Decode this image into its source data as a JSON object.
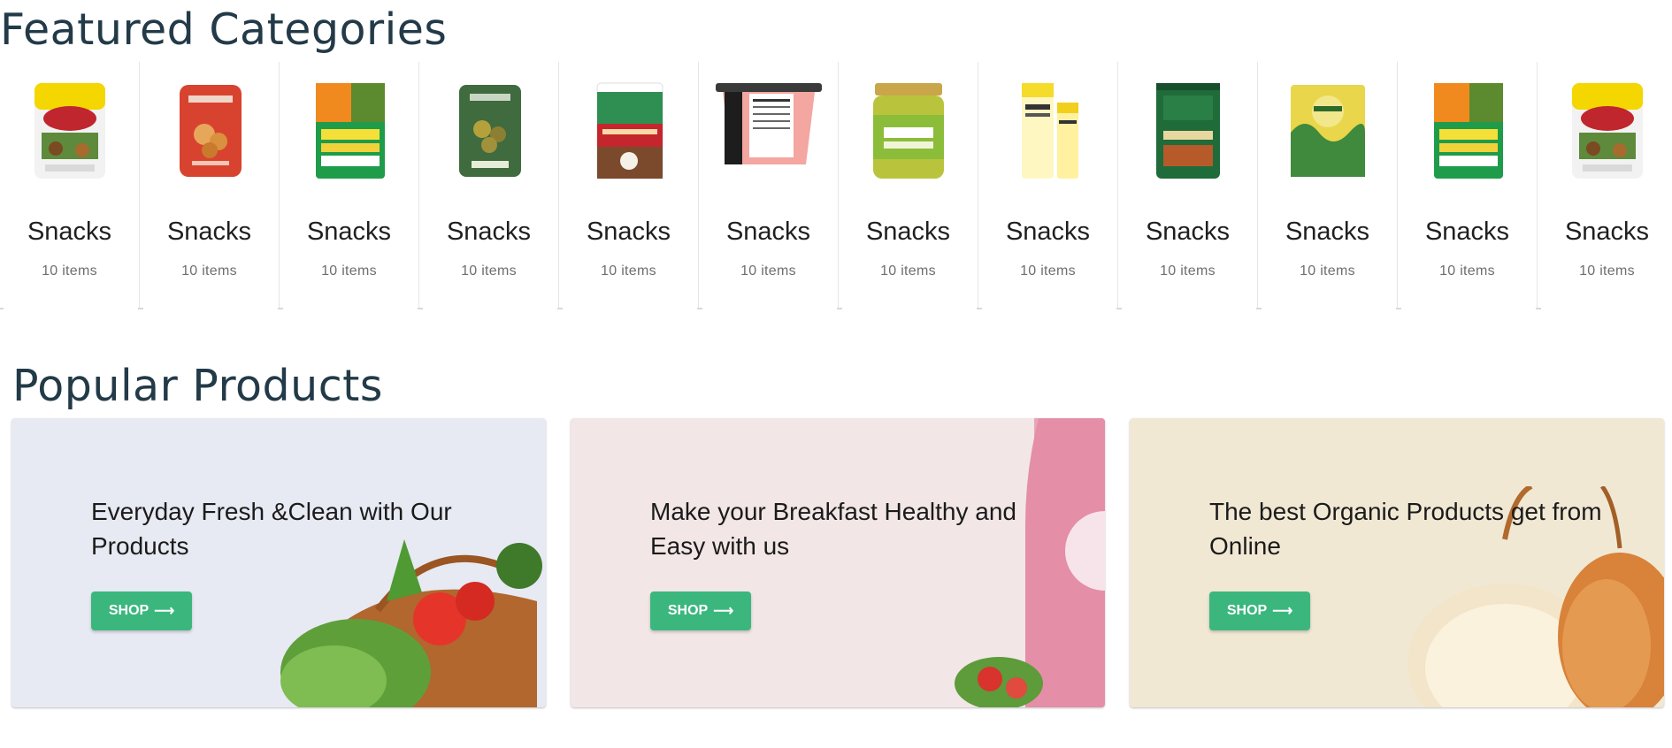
{
  "featured": {
    "title": "Featured Categories",
    "categories": [
      {
        "name": "Snacks",
        "count": "10 items",
        "icon": "trail-mix-bag"
      },
      {
        "name": "Snacks",
        "count": "10 items",
        "icon": "raspberry-crumble-bag"
      },
      {
        "name": "Snacks",
        "count": "10 items",
        "icon": "veggie-pops-bag"
      },
      {
        "name": "Snacks",
        "count": "10 items",
        "icon": "bean-nut-bag"
      },
      {
        "name": "Snacks",
        "count": "10 items",
        "icon": "coconut-flakes-bag"
      },
      {
        "name": "Snacks",
        "count": "10 items",
        "icon": "cup-container"
      },
      {
        "name": "Snacks",
        "count": "10 items",
        "icon": "pistachio-butter-jar"
      },
      {
        "name": "Snacks",
        "count": "10 items",
        "icon": "yuja-niacin-tubes"
      },
      {
        "name": "Snacks",
        "count": "10 items",
        "icon": "cafe-altura-can"
      },
      {
        "name": "Snacks",
        "count": "10 items",
        "icon": "pukka-tea-box"
      },
      {
        "name": "Snacks",
        "count": "10 items",
        "icon": "veggie-pops-bag"
      },
      {
        "name": "Snacks",
        "count": "10 items",
        "icon": "trail-mix-bag"
      }
    ]
  },
  "popular": {
    "title": "Popular Products",
    "banners": [
      {
        "text": "Everyday Fresh &Clean with Our Products",
        "button": "SHOP",
        "bg": "#e7e9f3",
        "art": "vegetable-basket"
      },
      {
        "text": "Make your Breakfast Healthy and Easy with us",
        "button": "SHOP",
        "bg": "#f2e6e6",
        "art": "milkshake-bottle"
      },
      {
        "text": "The best Organic Products get from Online",
        "button": "SHOP",
        "bg": "#f1e8d4",
        "art": "onions"
      }
    ]
  },
  "colors": {
    "accent": "#3bb77e",
    "heading": "#233a48"
  }
}
